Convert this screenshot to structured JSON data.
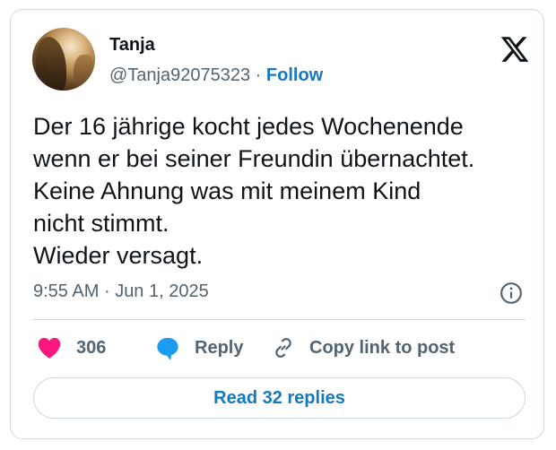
{
  "author": {
    "name": "Tanja",
    "handle": "@Tanja92075323",
    "separator": "·",
    "follow_label": "Follow",
    "avatar_icon": "profile-photo"
  },
  "brand": {
    "logo_icon": "x-logo"
  },
  "tweet": {
    "text": "Der 16 jährige kocht jedes Wochenende\nwenn er bei seiner Freundin übernachtet.\nKeine Ahnung was mit meinem Kind\nnicht stimmt.\nWieder versagt.",
    "time": "9:55 AM",
    "separator": "·",
    "date": "Jun 1, 2025"
  },
  "actions": {
    "like_count": "306",
    "reply_label": "Reply",
    "copy_link_label": "Copy link to post",
    "like_icon": "heart-icon",
    "reply_icon": "speech-bubble-icon",
    "copy_icon": "link-icon",
    "info_icon": "info-icon"
  },
  "footer": {
    "read_replies_label": "Read 32 replies"
  },
  "colors": {
    "accent": "#1479bf",
    "like": "#f91880",
    "reply": "#1d9bf0",
    "muted": "#536471",
    "border": "#cfd9de"
  }
}
